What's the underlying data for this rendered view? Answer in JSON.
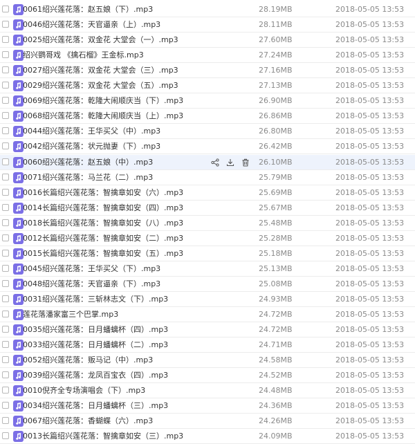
{
  "colors": {
    "accent": "#7b6fe6",
    "text": "#333333",
    "muted": "#8a8a8a",
    "hover_row": "#eef3fc"
  },
  "icons": {
    "file": "music-file-icon",
    "share": "share-icon",
    "download": "download-icon",
    "delete": "trash-icon"
  },
  "files": [
    {
      "name": "0061绍兴莲花落：赵五娘（下）.mp3",
      "size": "28.19MB",
      "date": "2018-05-05 13:53"
    },
    {
      "name": "0046绍兴莲花落：天官逼亲（上）.mp3",
      "size": "28.11MB",
      "date": "2018-05-05 13:53"
    },
    {
      "name": "0025绍兴莲花落：双金花  大堂会（一）.mp3",
      "size": "27.60MB",
      "date": "2018-05-05 13:53"
    },
    {
      "name": "绍兴鹦哥戏 《擒石榴》王金标.mp3",
      "size": "27.24MB",
      "date": "2018-05-05 13:53"
    },
    {
      "name": "0027绍兴莲花落：双金花  大堂会（三）.mp3",
      "size": "27.16MB",
      "date": "2018-05-05 13:53"
    },
    {
      "name": "0029绍兴莲花落：双金花  大堂会（五）.mp3",
      "size": "27.13MB",
      "date": "2018-05-05 13:53"
    },
    {
      "name": "0069绍兴莲花落：乾隆大闹顺庆当（下）.mp3",
      "size": "26.90MB",
      "date": "2018-05-05 13:53"
    },
    {
      "name": "0068绍兴莲花落：乾隆大闹顺庆当（上）.mp3",
      "size": "26.86MB",
      "date": "2018-05-05 13:53"
    },
    {
      "name": "0044绍兴莲花落：王华买父（中）.mp3",
      "size": "26.80MB",
      "date": "2018-05-05 13:53"
    },
    {
      "name": "0042绍兴莲花落：状元抛妻（下）.mp3",
      "size": "26.42MB",
      "date": "2018-05-05 13:53"
    },
    {
      "name": "0060绍兴莲花落：赵五娘（中）.mp3",
      "size": "26.10MB",
      "date": "2018-05-05 13:53",
      "hover": true
    },
    {
      "name": "0071绍兴莲花落：马兰花（二）.mp3",
      "size": "25.79MB",
      "date": "2018-05-05 13:53"
    },
    {
      "name": "0016长篇绍兴莲花落：智擒章如安（六）.mp3",
      "size": "25.69MB",
      "date": "2018-05-05 13:53"
    },
    {
      "name": "0014长篇绍兴莲花落：智擒章如安（四）.mp3",
      "size": "25.67MB",
      "date": "2018-05-05 13:53"
    },
    {
      "name": "0018长篇绍兴莲花落：智擒章如安（八）.mp3",
      "size": "25.48MB",
      "date": "2018-05-05 13:53"
    },
    {
      "name": "0012长篇绍兴莲花落：智擒章如安（二）.mp3",
      "size": "25.28MB",
      "date": "2018-05-05 13:53"
    },
    {
      "name": "0015长篇绍兴莲花落：智擒章如安（五）.mp3",
      "size": "25.18MB",
      "date": "2018-05-05 13:53"
    },
    {
      "name": "0045绍兴莲花落：王华买父（下）.mp3",
      "size": "25.13MB",
      "date": "2018-05-05 13:53"
    },
    {
      "name": "0048绍兴莲花落：天官逼亲（下）.mp3",
      "size": "25.08MB",
      "date": "2018-05-05 13:53"
    },
    {
      "name": "0031绍兴莲花落：三斩林志文（下）.mp3",
      "size": "24.93MB",
      "date": "2018-05-05 13:53"
    },
    {
      "name": "莲花落潘家富三个巴掌.mp3",
      "size": "24.72MB",
      "date": "2018-05-05 13:53"
    },
    {
      "name": "0035绍兴莲花落：日月蟠螭杯（四）.mp3",
      "size": "24.72MB",
      "date": "2018-05-05 13:53"
    },
    {
      "name": "0033绍兴莲花落：日月蟠螭杯（二）.mp3",
      "size": "24.71MB",
      "date": "2018-05-05 13:53"
    },
    {
      "name": "0052绍兴莲花落：贩马记（中）.mp3",
      "size": "24.58MB",
      "date": "2018-05-05 13:53"
    },
    {
      "name": "0039绍兴莲花落：龙凤百宝衣（四）.mp3",
      "size": "24.52MB",
      "date": "2018-05-05 13:53"
    },
    {
      "name": "0010倪齐全专场演唱会（下）.mp3",
      "size": "24.48MB",
      "date": "2018-05-05 13:53"
    },
    {
      "name": "0034绍兴莲花落：日月蟠螭杯（三）.mp3",
      "size": "24.36MB",
      "date": "2018-05-05 13:53"
    },
    {
      "name": "0067绍兴莲花落：香蝴蝶（六）.mp3",
      "size": "24.26MB",
      "date": "2018-05-05 13:53"
    },
    {
      "name": "0013长篇绍兴莲花落：智擒章如安（三）.mp3",
      "size": "24.09MB",
      "date": "2018-05-05 13:53"
    }
  ]
}
